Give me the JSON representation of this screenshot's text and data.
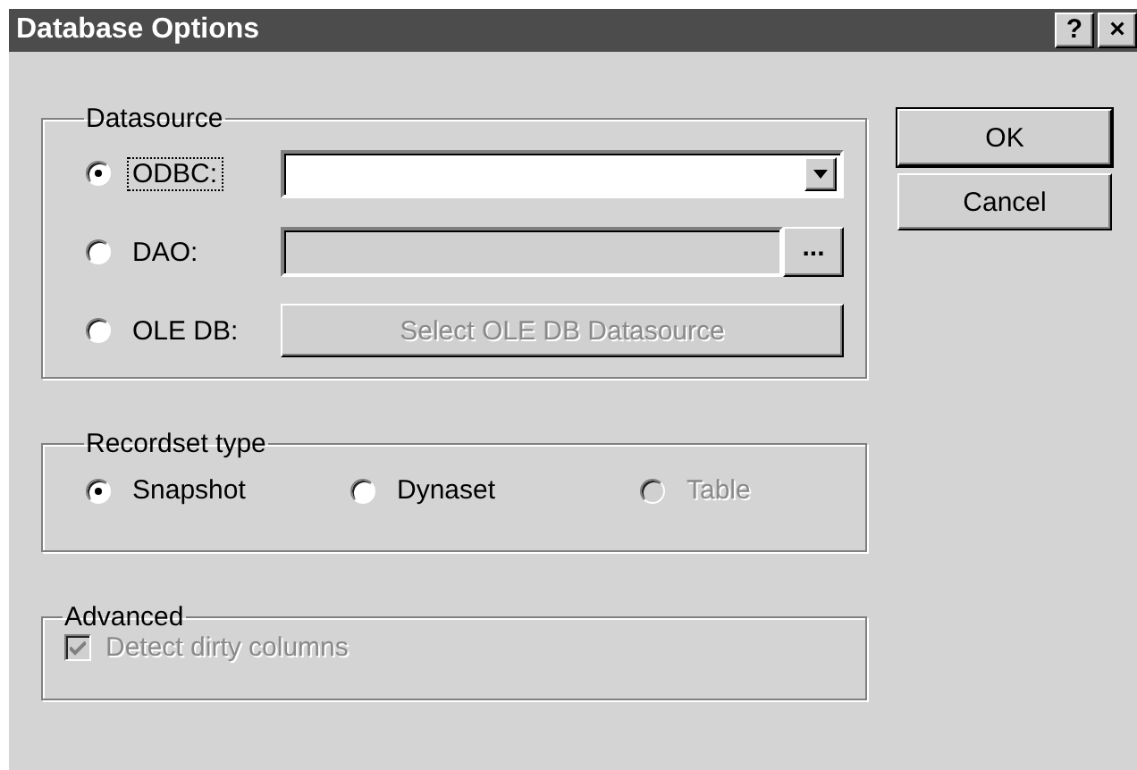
{
  "window": {
    "title": "Database Options",
    "help_button": "?",
    "close_button": "×"
  },
  "datasource": {
    "title": "Datasource",
    "options": [
      {
        "kind": "combo",
        "label": "ODBC:",
        "selected": true,
        "focused": true,
        "field_disabled": false
      },
      {
        "kind": "browse",
        "label": "DAO:",
        "selected": false,
        "focused": false,
        "field_disabled": true,
        "button": "..."
      },
      {
        "kind": "button",
        "label": "OLE DB:",
        "selected": false,
        "focused": false,
        "field_disabled": true,
        "button": "Select OLE DB Datasource"
      }
    ]
  },
  "recordset_type": {
    "title": "Recordset type",
    "options": [
      {
        "label": "Snapshot",
        "selected": true,
        "disabled": false
      },
      {
        "label": "Dynaset",
        "selected": false,
        "disabled": false
      },
      {
        "label": "Table",
        "selected": false,
        "disabled": true
      }
    ]
  },
  "advanced": {
    "title": "Advanced",
    "checkbox": {
      "label": "Detect dirty columns",
      "checked": true,
      "disabled": true
    }
  },
  "buttons": [
    {
      "label": "OK",
      "default": true
    },
    {
      "label": "Cancel",
      "default": false
    }
  ]
}
